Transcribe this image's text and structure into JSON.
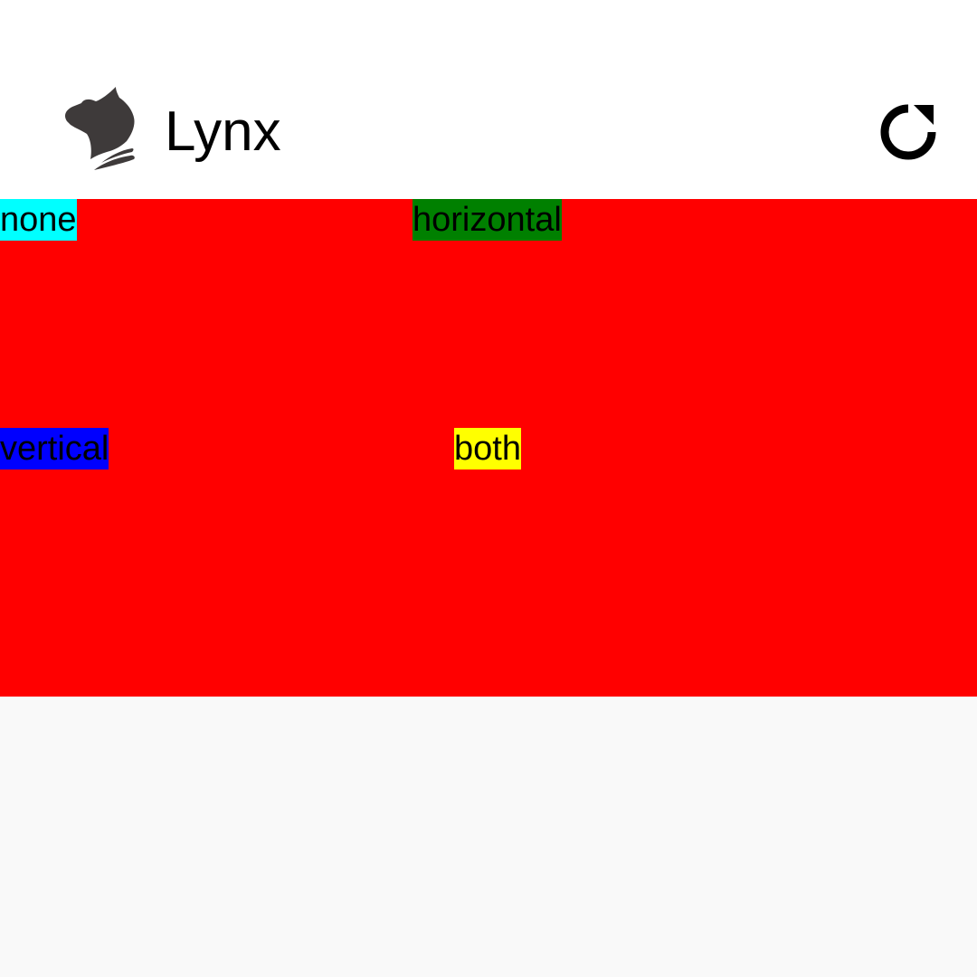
{
  "app_bar": {
    "title": "Lynx",
    "logo_icon": "lynx-logo-icon",
    "reload_icon": "reload-icon"
  },
  "content": {
    "background": "#ff0000",
    "items": [
      {
        "label": "none",
        "color": "#00ffff"
      },
      {
        "label": "horizontal",
        "color": "#008000"
      },
      {
        "label": "vertical",
        "color": "#0000ff"
      },
      {
        "label": "both",
        "color": "#ffff00"
      }
    ]
  },
  "page_background": "#f9f9f9"
}
